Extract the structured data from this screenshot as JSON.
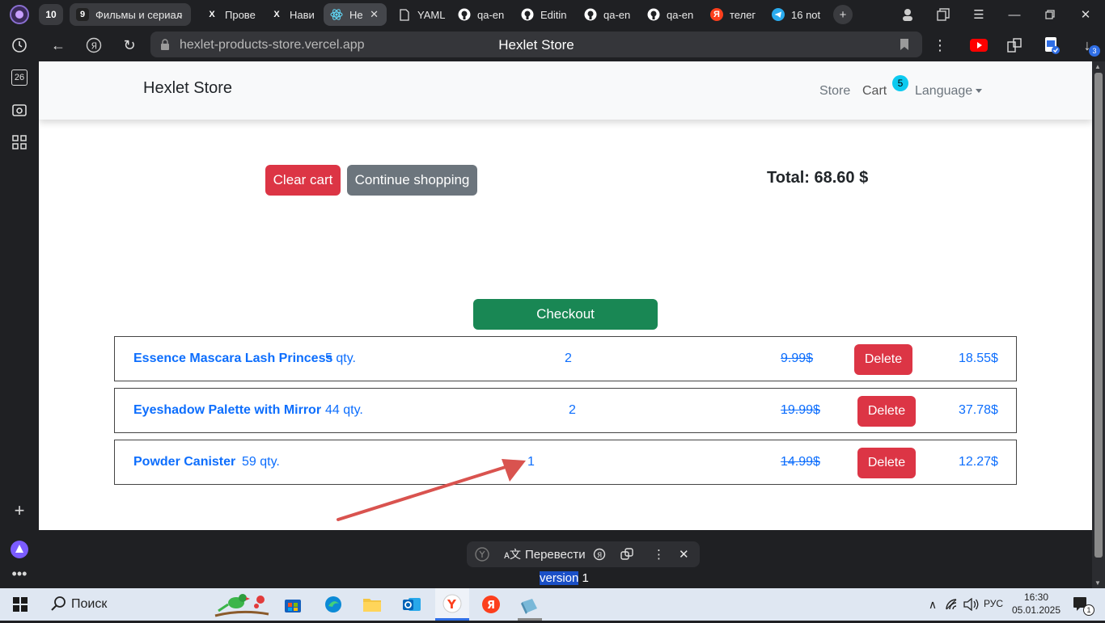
{
  "browser": {
    "tab_count": "10",
    "tabs": [
      {
        "label": "Фильмы и сериал",
        "icon": "9"
      },
      {
        "label": "Прове",
        "icon": "X"
      },
      {
        "label": "Нави",
        "icon": "X"
      },
      {
        "label": "He",
        "icon": "react"
      },
      {
        "label": "YAML",
        "icon": "doc"
      },
      {
        "label": "qa-en",
        "icon": "github"
      },
      {
        "label": "Editin",
        "icon": "github"
      },
      {
        "label": "qa-en",
        "icon": "github"
      },
      {
        "label": "qa-en",
        "icon": "github"
      },
      {
        "label": "телег",
        "icon": "Я"
      },
      {
        "label": "16 not",
        "icon": "telegram"
      }
    ],
    "sidebar_date": "26",
    "url": "hexlet-products-store.vercel.app",
    "page_title": "Hexlet Store",
    "downloads_badge": "3"
  },
  "store": {
    "brand": "Hexlet Store",
    "nav": {
      "store": "Store",
      "cart": "Cart",
      "cart_count": "5",
      "language": "Language"
    },
    "actions": {
      "clear_cart": "Clear cart",
      "continue_shopping": "Continue shopping",
      "total": "Total: 68.60 $",
      "checkout": "Checkout"
    },
    "items": [
      {
        "name": "Essence Mascara Lash Princess",
        "qty": "5 qty.",
        "count": "2",
        "old_price": "9.99$",
        "delete": "Delete",
        "price": "18.55$"
      },
      {
        "name": "Eyeshadow Palette with Mirror",
        "qty": "44 qty.",
        "count": "2",
        "old_price": "19.99$",
        "delete": "Delete",
        "price": "37.78$"
      },
      {
        "name": "Powder Canister",
        "qty": "59 qty.",
        "count": "1",
        "old_price": "14.99$",
        "delete": "Delete",
        "price": "12.27$"
      }
    ]
  },
  "translate_bar": {
    "translate_label": "Перевести",
    "selected_text": "version",
    "following_text": " 1"
  },
  "taskbar": {
    "search_label": "Поиск",
    "language": "РУС",
    "time": "16:30",
    "date": "05.01.2025",
    "notifications": "1"
  },
  "colors": {
    "danger": "#dc3545",
    "secondary": "#6c757d",
    "success": "#198754",
    "link": "#0d6efd",
    "badge": "#0dcaf0",
    "arrow": "#d9534f"
  }
}
